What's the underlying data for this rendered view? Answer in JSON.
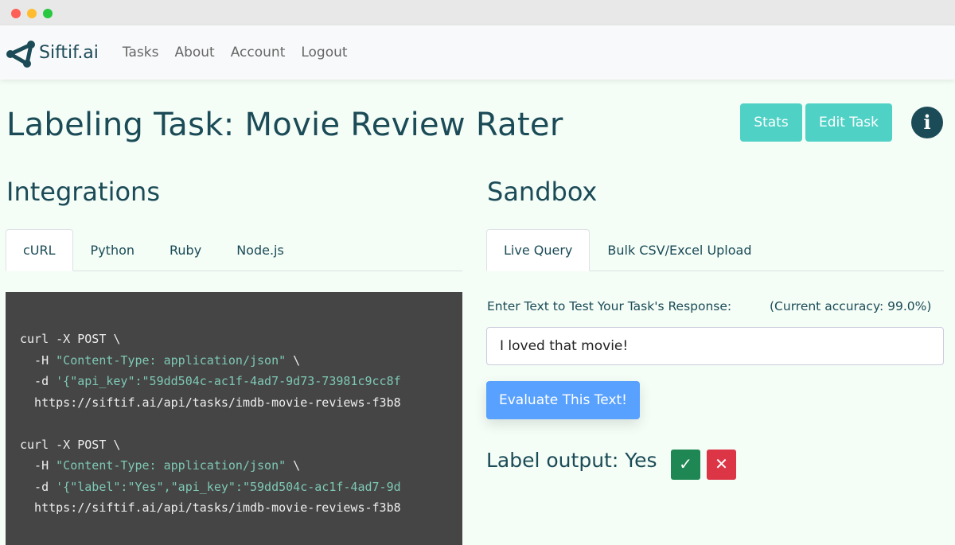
{
  "nav": {
    "brand": "Siftif.ai",
    "items": [
      "Tasks",
      "About",
      "Account",
      "Logout"
    ]
  },
  "header": {
    "title": "Labeling Task: Movie Review Rater",
    "stats_label": "Stats",
    "edit_label": "Edit Task",
    "info_icon": "info-icon"
  },
  "integrations": {
    "title": "Integrations",
    "tabs": [
      "cURL",
      "Python",
      "Ruby",
      "Node.js"
    ],
    "active_tab": "cURL",
    "code": [
      {
        "pre": "curl -X POST \\",
        "str": "",
        "post": ""
      },
      {
        "pre": "  -H ",
        "str": "\"Content-Type: application/json\"",
        "post": " \\"
      },
      {
        "pre": "  -d ",
        "str": "'{\"api_key\":\"59dd504c-ac1f-4ad7-9d73-73981c9cc8f",
        "post": ""
      },
      {
        "pre": "  https://siftif.ai/api/tasks/imdb-movie-reviews-f3b8",
        "str": "",
        "post": ""
      },
      {
        "pre": "",
        "str": "",
        "post": ""
      },
      {
        "pre": "curl -X POST \\",
        "str": "",
        "post": ""
      },
      {
        "pre": "  -H ",
        "str": "\"Content-Type: application/json\"",
        "post": " \\"
      },
      {
        "pre": "  -d ",
        "str": "'{\"label\":\"Yes\",\"api_key\":\"59dd504c-ac1f-4ad7-9d",
        "post": ""
      },
      {
        "pre": "  https://siftif.ai/api/tasks/imdb-movie-reviews-f3b8",
        "str": "",
        "post": ""
      }
    ]
  },
  "sandbox": {
    "title": "Sandbox",
    "tabs": [
      "Live Query",
      "Bulk CSV/Excel Upload"
    ],
    "active_tab": "Live Query",
    "prompt": "Enter Text to Test Your Task's Response:",
    "accuracy": "(Current accuracy: 99.0%)",
    "input_value": "I loved that movie!",
    "evaluate_label": "Evaluate This Text!",
    "output": "Label output: Yes",
    "confirm": "✓",
    "reject": "✕"
  },
  "colors": {
    "primary": "#1b4b57",
    "teal": "#4fd1c5",
    "blue": "#58a1ff",
    "success": "#1e8753",
    "danger": "#dc3545"
  }
}
